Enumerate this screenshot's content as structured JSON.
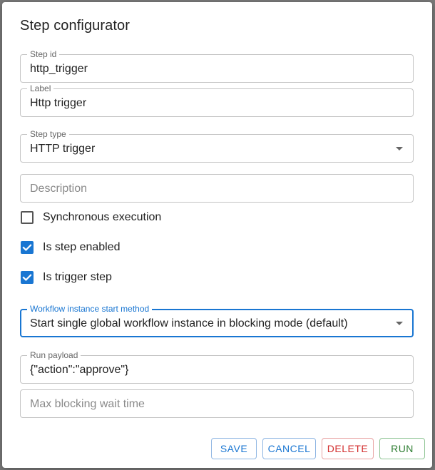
{
  "dialog": {
    "title": "Step configurator"
  },
  "fields": {
    "step_id": {
      "label": "Step id",
      "value": "http_trigger"
    },
    "label": {
      "label": "Label",
      "value": "Http trigger"
    },
    "step_type": {
      "label": "Step type",
      "value": "HTTP trigger"
    },
    "description": {
      "placeholder": "Description"
    },
    "start_method": {
      "label": "Workflow instance start method",
      "value": "Start single global workflow instance in blocking mode (default)"
    },
    "run_payload": {
      "label": "Run payload",
      "value": "{\"action\":\"approve\"}"
    },
    "max_wait": {
      "placeholder": "Max blocking wait time"
    }
  },
  "checkboxes": {
    "synchronous": {
      "label": "Synchronous execution",
      "checked": false
    },
    "enabled": {
      "label": "Is step enabled",
      "checked": true
    },
    "trigger": {
      "label": "Is trigger step",
      "checked": true
    }
  },
  "actions": {
    "save": "SAVE",
    "cancel": "CANCEL",
    "delete": "DELETE",
    "run": "RUN"
  },
  "colors": {
    "primary": "#1976d2",
    "danger": "#d32f2f",
    "success": "#2e7d32"
  }
}
